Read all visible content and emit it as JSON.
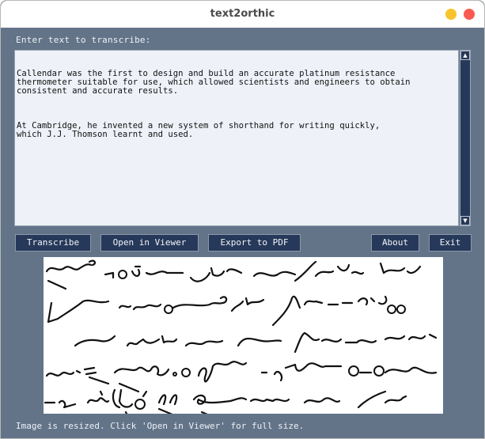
{
  "window": {
    "title": "text2orthic",
    "controls": {
      "minimize_color": "#f8c42b",
      "close_color": "#f85a52"
    }
  },
  "input": {
    "label": "Enter text to transcribe:",
    "paragraphs": [
      "Callendar was the first to design and build an accurate platinum resistance\nthermometer suitable for use, which allowed scientists and engineers to obtain\nconsistent and accurate results.",
      "At Cambridge, he invented a new system of shorthand for writing quickly,\nwhich J.J. Thomson learnt and used."
    ]
  },
  "scrollbar": {
    "up_icon": "▲",
    "down_icon": "▼"
  },
  "toolbar": {
    "transcribe": "Transcribe",
    "open_viewer": "Open in Viewer",
    "export_pdf": "Export to PDF",
    "about": "About",
    "exit": "Exit"
  },
  "preview": {
    "description": "Orthic shorthand transcription image (5 lines of handwritten strokes)"
  },
  "status": {
    "message": "Image is resized. Click 'Open in Viewer' for full size."
  },
  "colors": {
    "background": "#637489",
    "button": "#27395a",
    "textarea": "#eef2f8"
  }
}
